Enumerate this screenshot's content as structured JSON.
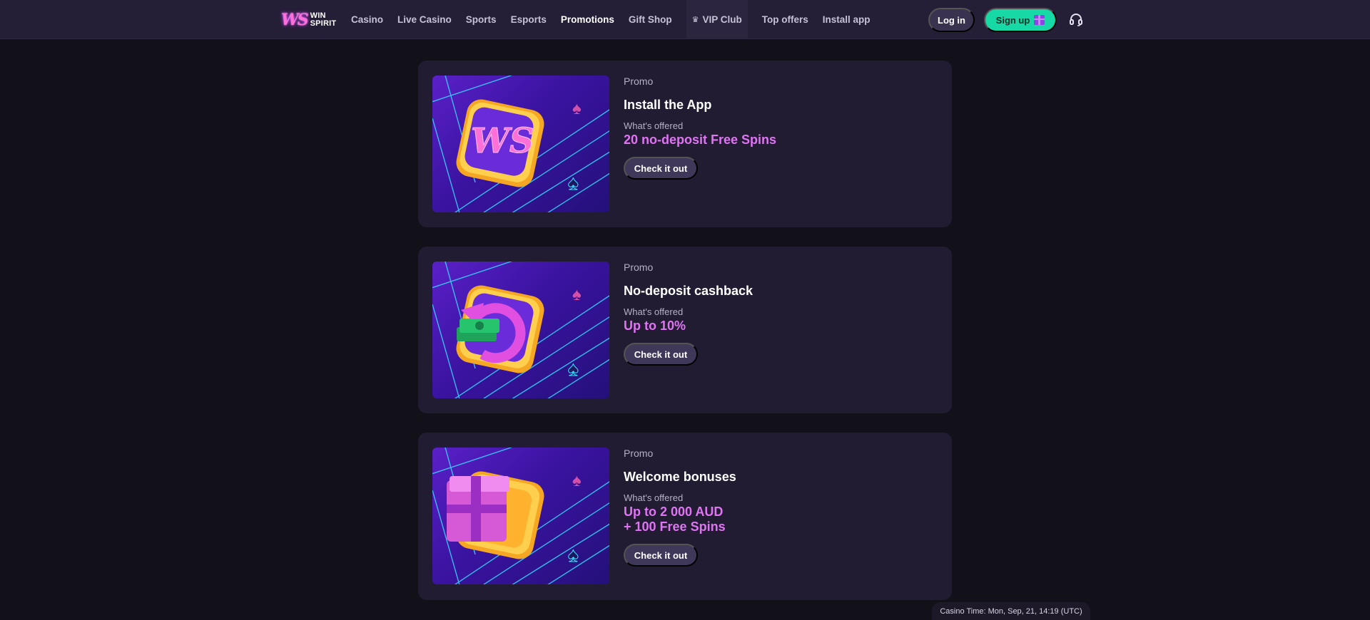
{
  "header": {
    "logo_text_line1": "WIN",
    "logo_text_line2": "SPIRIT",
    "logo_mark": "WS",
    "nav": [
      {
        "label": "Casino"
      },
      {
        "label": "Live Casino"
      },
      {
        "label": "Sports"
      },
      {
        "label": "Esports"
      },
      {
        "label": "Promotions",
        "active": true
      },
      {
        "label": "Gift Shop"
      },
      {
        "label": "VIP Club",
        "icon": "crown-icon"
      },
      {
        "label": "Top offers"
      },
      {
        "label": "Install app"
      }
    ],
    "login_label": "Log in",
    "signup_label": "Sign up",
    "signup_icon": "gift-icon",
    "support_icon": "headset-icon"
  },
  "promos": [
    {
      "type": "Promo",
      "title": "Install the App",
      "offered_label": "What's offered",
      "offer_line1": "20 no-deposit Free Spins",
      "offer_line2": "",
      "button_label": "Check it out",
      "image_icon": "ws-logo-icon"
    },
    {
      "type": "Promo",
      "title": "No-deposit cashback",
      "offered_label": "What's offered",
      "offer_line1": "Up to 10%",
      "offer_line2": "",
      "button_label": "Check it out",
      "image_icon": "cashback-icon"
    },
    {
      "type": "Promo",
      "title": "Welcome bonuses",
      "offered_label": "What's offered",
      "offer_line1": "Up to 2 000 AUD",
      "offer_line2": "+ 100 Free Spins",
      "button_label": "Check it out",
      "image_icon": "gift-box-icon"
    }
  ],
  "footer": {
    "casino_time": "Casino Time: Mon, Sep, 21, 14:19 (UTC)"
  },
  "colors": {
    "background": "#121019",
    "header": "#241e36",
    "card": "#211c31",
    "accent_offer": "#e074f5",
    "signup": "#17d9a5"
  }
}
